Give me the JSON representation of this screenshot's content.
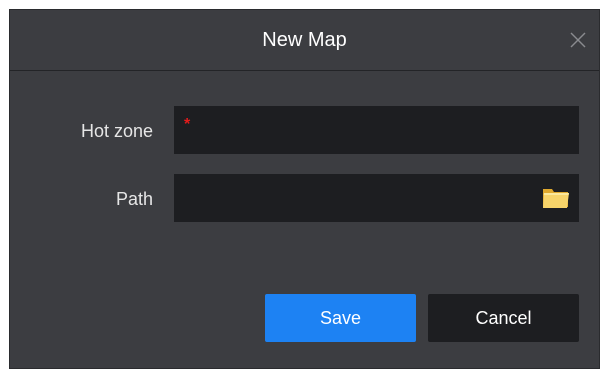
{
  "dialog": {
    "title": "New Map",
    "close_icon": "close-icon"
  },
  "form": {
    "hot_zone": {
      "label": "Hot zone",
      "required_mark": "*",
      "value": ""
    },
    "path": {
      "label": "Path",
      "value": "",
      "browse_icon": "folder-icon"
    }
  },
  "actions": {
    "save_label": "Save",
    "cancel_label": "Cancel"
  },
  "colors": {
    "dialog_bg": "#3c3d41",
    "field_bg": "#1d1e21",
    "accent": "#1d82f3",
    "required": "#e31b1b"
  }
}
